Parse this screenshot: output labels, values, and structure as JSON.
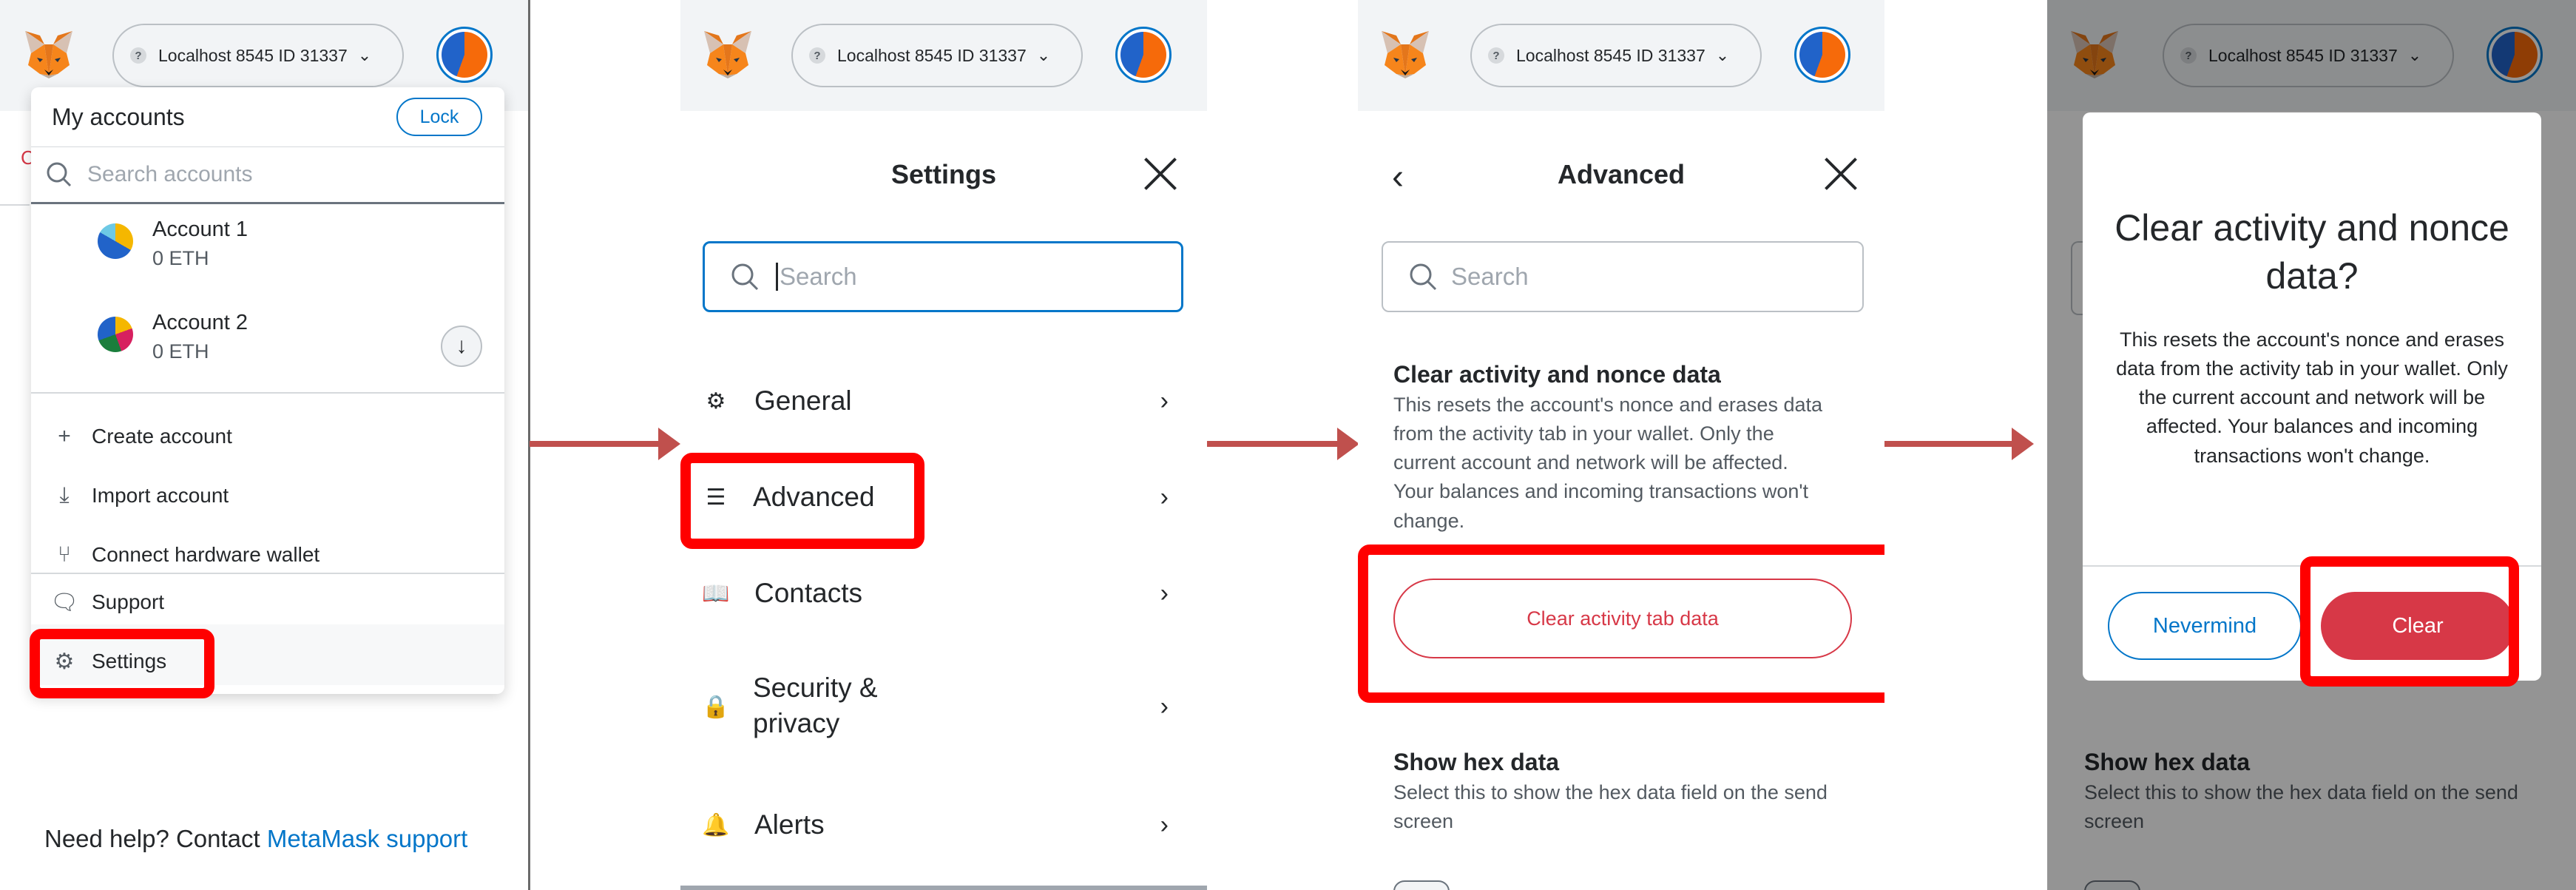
{
  "network_label": "Localhost 8545 ID 31337",
  "network_help": "?",
  "panel1": {
    "menu_title": "My accounts",
    "lock_label": "Lock",
    "search_placeholder": "Search accounts",
    "accounts": [
      {
        "name": "Account 1",
        "balance": "0 ETH"
      },
      {
        "name": "Account 2",
        "balance": "0 ETH"
      }
    ],
    "items": {
      "create": "Create account",
      "import": "Import account",
      "hardware": "Connect hardware wallet",
      "support": "Support",
      "settings": "Settings"
    },
    "help_prefix": "Need help? Contact",
    "help_link": "MetaMask support",
    "red_text_glyph": "C"
  },
  "panel2": {
    "title": "Settings",
    "search_placeholder": "Search",
    "rows": [
      {
        "label": "General",
        "icon": "gear-icon"
      },
      {
        "label": "Advanced",
        "icon": "sliders-icon"
      },
      {
        "label": "Contacts",
        "icon": "book-icon"
      },
      {
        "label": "Security &\nprivacy",
        "icon": "lock-icon"
      },
      {
        "label": "Alerts",
        "icon": "bell-icon"
      }
    ]
  },
  "panel3": {
    "title": "Advanced",
    "search_placeholder": "Search",
    "clear_heading": "Clear activity and nonce data",
    "clear_desc": "This resets the account's nonce and erases data from the activity tab in your wallet. Only the current account and network will be affected. Your balances and incoming transactions won't change.",
    "clear_button": "Clear activity tab data",
    "hex_heading": "Show hex data",
    "hex_desc": "Select this to show the hex data field on the send screen"
  },
  "panel4": {
    "modal_title": "Clear activity and nonce data?",
    "modal_desc": "This resets the account's nonce and erases data from the activity tab in your wallet. Only the current account and network will be affected. Your balances and incoming transactions won't change.",
    "nevermind": "Nevermind",
    "clear": "Clear",
    "hex_heading": "Show hex data",
    "hex_desc": "Select this to show the hex data field on the send screen"
  },
  "colors": {
    "accent": "#0376c9",
    "danger": "#d73847",
    "highlight": "#ff0000",
    "arrow": "#c0504d"
  }
}
